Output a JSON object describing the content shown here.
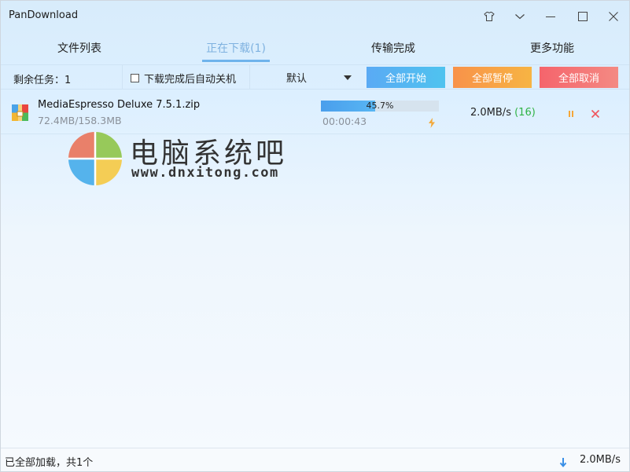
{
  "window": {
    "title": "PanDownload"
  },
  "titlebar_buttons": [
    {
      "name": "skin-icon"
    },
    {
      "name": "dropdown-icon"
    },
    {
      "name": "minimize-icon"
    },
    {
      "name": "maximize-icon"
    },
    {
      "name": "close-icon"
    }
  ],
  "tabs": [
    {
      "label": "文件列表",
      "active": false
    },
    {
      "label": "正在下载(1)",
      "active": true
    },
    {
      "label": "传输完成",
      "active": false
    },
    {
      "label": "更多功能",
      "active": false
    }
  ],
  "toolbar": {
    "remaining_tasks": "剩余任务：1",
    "shutdown_label": "下载完成后自动关机",
    "shutdown_checked": false,
    "sort_value": "默认",
    "start_all": "全部开始",
    "pause_all": "全部暂停",
    "cancel_all": "全部取消"
  },
  "downloads": [
    {
      "file_name": "MediaEspresso Deluxe 7.5.1.zip",
      "size": "72.4MB/158.3MB",
      "progress_text": "45.7%",
      "progress": 0.457,
      "elapsed": "00:00:43",
      "speed": "2.0MB/s",
      "connections": "(16)"
    }
  ],
  "watermark": {
    "title": "电脑系统吧",
    "url": "www.dnxitong.com"
  },
  "statusbar": {
    "text": "已全部加载，共1个",
    "speed": "2.0MB/s"
  },
  "colors": {
    "accent": "#6fb3ec",
    "start": "#5aaaf4",
    "pause": "#f8924a",
    "cancel": "#f5646c",
    "connections": "#2fb344"
  }
}
